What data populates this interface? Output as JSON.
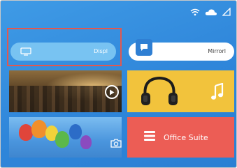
{
  "screen": {
    "status_icons": [
      "wifi-icon",
      "cloud-icon",
      "signal-icon"
    ],
    "menu": [
      {
        "id": "display",
        "label": "Displ",
        "icon": "monitor-icon",
        "focused": true
      },
      {
        "id": "mirror",
        "label": "Mirrorl",
        "icon": "chat-bubble-icon",
        "focused": false
      }
    ],
    "tiles": [
      {
        "id": "video",
        "icon": "play-icon"
      },
      {
        "id": "music",
        "icon": "music-note-icon"
      },
      {
        "id": "photo",
        "icon": "camera-icon"
      },
      {
        "id": "office",
        "label": "Office Suite",
        "icon": "document-lines-icon"
      }
    ]
  },
  "colors": {
    "background": "#3f9be6",
    "focus_border": "#e2584f",
    "display_pill": "#78c3f2",
    "music_tile": "#f2c33c",
    "office_tile": "#ec5d55"
  }
}
